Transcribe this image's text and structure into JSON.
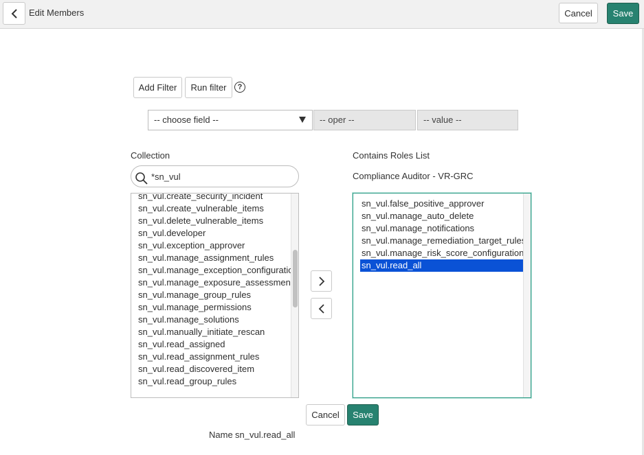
{
  "header": {
    "title": "Edit Members",
    "cancel_label": "Cancel",
    "save_label": "Save"
  },
  "filter": {
    "add_filter_label": "Add Filter",
    "run_filter_label": "Run filter",
    "help_symbol": "?",
    "field_placeholder": "-- choose field --",
    "oper_placeholder": "-- oper --",
    "value_placeholder": "-- value --"
  },
  "collection": {
    "label": "Collection",
    "search_value": "*sn_vul",
    "items": [
      "sn_vul.create_security_incident",
      "sn_vul.create_vulnerable_items",
      "sn_vul.delete_vulnerable_items",
      "sn_vul.developer",
      "sn_vul.exception_approver",
      "sn_vul.manage_assignment_rules",
      "sn_vul.manage_exception_configuration",
      "sn_vul.manage_exposure_assessment",
      "sn_vul.manage_group_rules",
      "sn_vul.manage_permissions",
      "sn_vul.manage_solutions",
      "sn_vul.manually_initiate_rescan",
      "sn_vul.read_assigned",
      "sn_vul.read_assignment_rules",
      "sn_vul.read_discovered_item",
      "sn_vul.read_group_rules"
    ]
  },
  "roles": {
    "label": "Contains Roles List",
    "subtitle": "Compliance Auditor - VR-GRC",
    "items": [
      "sn_vul.false_positive_approver",
      "sn_vul.manage_auto_delete",
      "sn_vul.manage_notifications",
      "sn_vul.manage_remediation_target_rules",
      "sn_vul.manage_risk_score_configuration",
      "sn_vul.read_all"
    ],
    "selected": "sn_vul.read_all"
  },
  "footer": {
    "cancel_label": "Cancel",
    "save_label": "Save",
    "name_label": "Name",
    "name_value": "sn_vul.read_all"
  },
  "colors": {
    "primary": "#278270",
    "selection": "#0a52d6",
    "focus_border": "#2e9b85"
  },
  "icons": {
    "back": "chevron-left-icon",
    "search": "magnifier-icon",
    "add": "chevron-right-icon",
    "remove": "chevron-left-icon",
    "dropdown": "triangle-down-icon",
    "help": "question-circle-icon"
  }
}
